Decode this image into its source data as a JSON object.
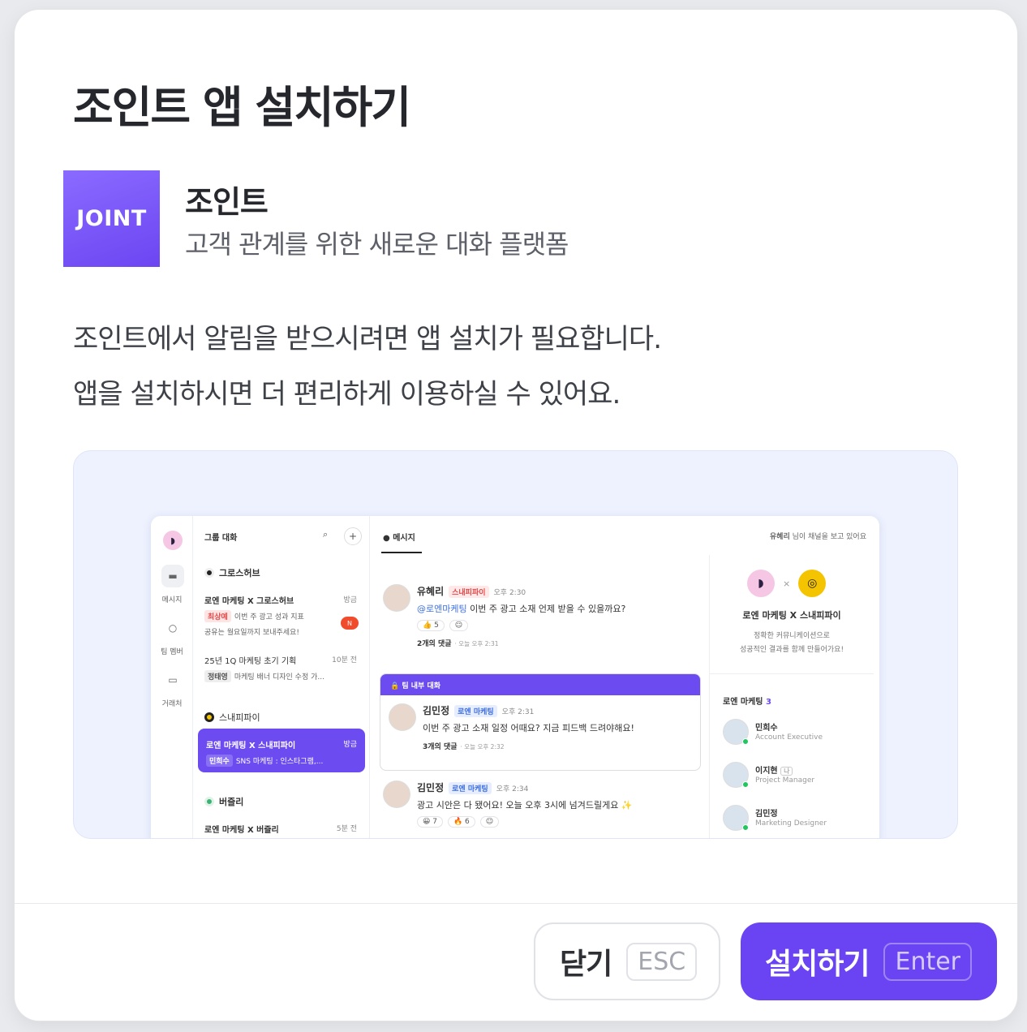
{
  "dialog": {
    "title": "조인트 앱 설치하기",
    "app": {
      "logo_text": "JOINT",
      "name": "조인트",
      "description": "고객 관계를 위한 새로운 대화 플랫폼"
    },
    "message_line1": "조인트에서 알림을 받으시려면 앱 설치가 필요합니다.",
    "message_line2": "앱을 설치하시면 더 편리하게 이용하실 수 있어요.",
    "buttons": {
      "close_label": "닫기",
      "close_key": "ESC",
      "install_label": "설치하기",
      "install_key": "Enter"
    },
    "colors": {
      "accent": "#6a44f2",
      "logo_gradient_start": "#8a6bff"
    }
  },
  "preview": {
    "rail": {
      "messages": "메시지",
      "team": "팀 멤버",
      "clients": "거래처"
    },
    "list": {
      "header": "그룹 대화",
      "groups": [
        {
          "name": "그로스허브",
          "items": [
            {
              "title": "로엔 마케팅 X 그로스허브",
              "time": "방금",
              "tag": "최상예",
              "snippet1": "이번 주 광고 성과 지표",
              "snippet2": "공유는 월요일까지 보내주세요!",
              "badge": "N"
            },
            {
              "title": "25년 1Q 마케팅 초기 기획",
              "time": "10분 전",
              "tag": "정태영",
              "snippet1": "마케팅 배너 디자인 수정 가..."
            }
          ]
        },
        {
          "name": "스내피파이",
          "items": [
            {
              "title": "로엔 마케팅 X 스내피파이",
              "time": "방금",
              "tag": "민희수",
              "snippet1": "SNS 마케팅 : 인스타그램,..."
            }
          ]
        },
        {
          "name": "버즐리",
          "items": [
            {
              "title": "로엔 마케팅 X 버즐리",
              "time": "5분 전"
            }
          ]
        }
      ]
    },
    "chat": {
      "tab": "메시지",
      "viewer_name": "유혜리",
      "viewer_text": "님이 채널을 보고 있어요",
      "messages": [
        {
          "name": "유혜리",
          "tag": "스내피파이",
          "time": "오후 2:30",
          "mention": "@로엔마케팅",
          "text": "이번 주 광고 소재 언제 받을 수 있을까요?",
          "reaction": "👍 5",
          "thread": "2개의 댓글",
          "thread_time": "· 오늘 오후 2:31"
        }
      ],
      "internal_label": "팀 내부 대화",
      "internal_messages": [
        {
          "name": "김민정",
          "tag": "로엔 마케팅",
          "time": "오후 2:31",
          "text": "이번 주 광고 소재 일정 어때요? 지금 피드백 드려야해요!",
          "thread": "3개의 댓글",
          "thread_time": "· 오늘 오후 2:32"
        }
      ],
      "last_message": {
        "name": "김민정",
        "tag": "로엔 마케팅",
        "time": "오후 2:34",
        "text": "광고 시안은 다 됐어요! 오늘 오후 3시에 넘겨드릴게요 ✨",
        "reaction1": "😀 7",
        "reaction2": "🔥 6"
      }
    },
    "side": {
      "channel_title": "로엔 마케팅 X 스내피파이",
      "desc1": "정확한 커뮤니케이션으로",
      "desc2": "성공적인 결과를 함께 만들어가요!",
      "team_label": "로엔 마케팅",
      "team_count": "3",
      "members": [
        {
          "name": "민희수",
          "role": "Account Executive"
        },
        {
          "name": "이지현",
          "role": "Project Manager",
          "badge": "나"
        },
        {
          "name": "김민정",
          "role": "Marketing Designer"
        }
      ]
    }
  }
}
